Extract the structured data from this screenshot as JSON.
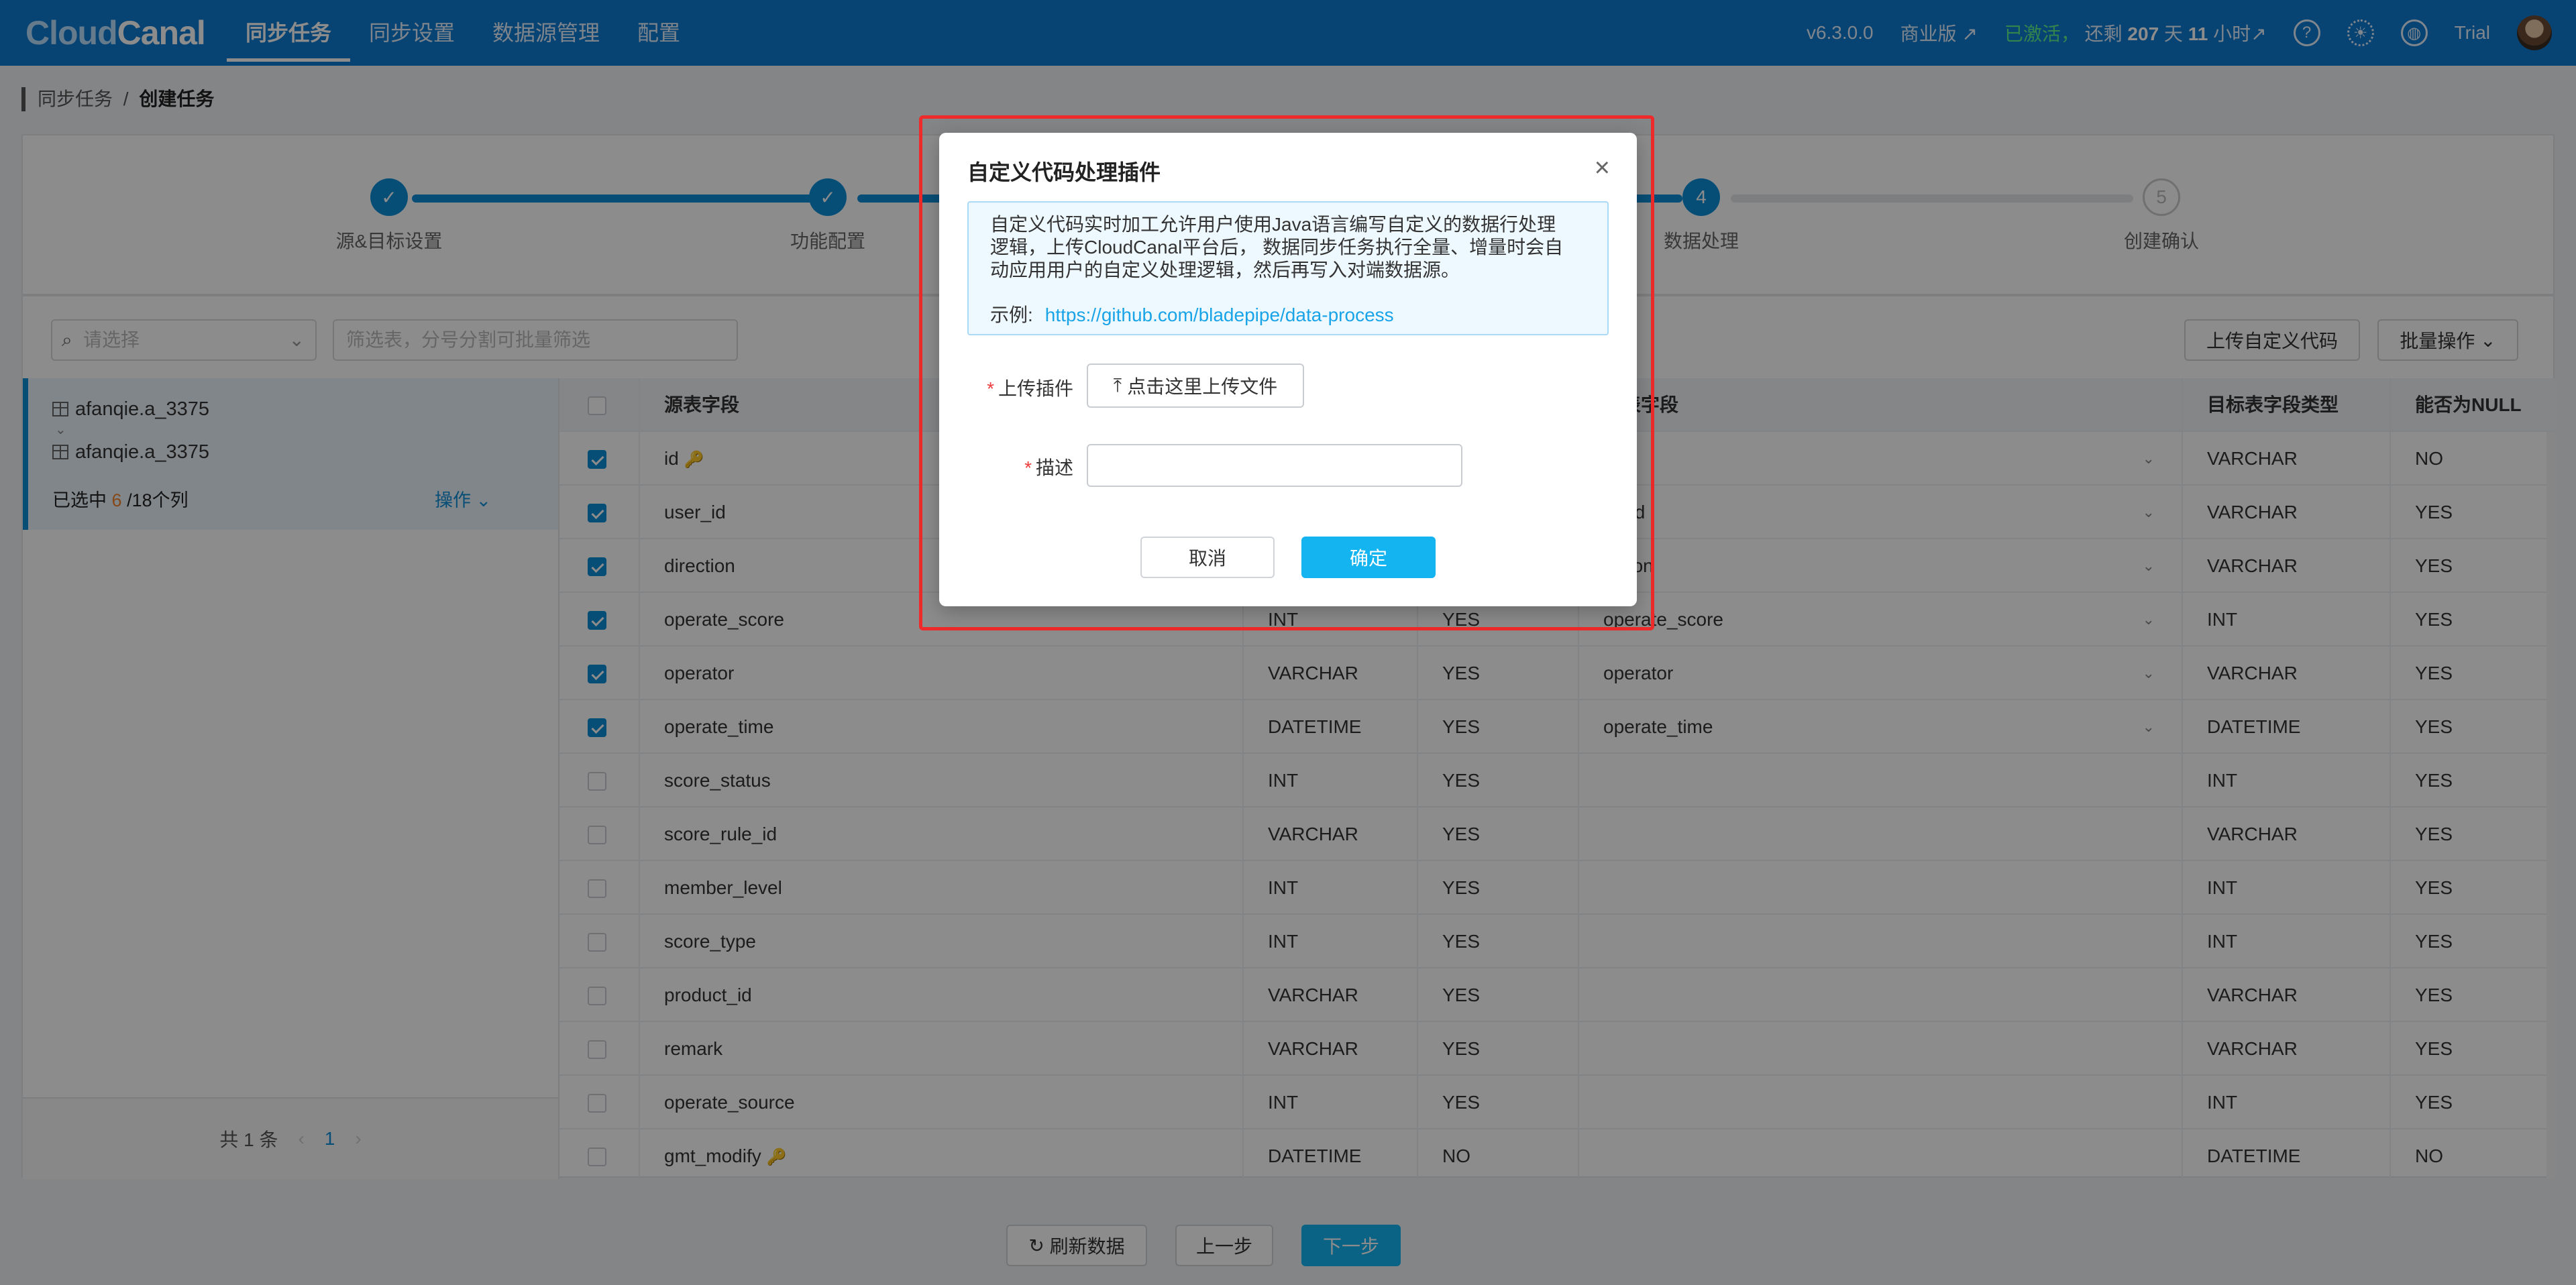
{
  "topbar": {
    "logo_a": "Cloud",
    "logo_b": "Canal",
    "nav": [
      "同步任务",
      "同步设置",
      "数据源管理",
      "配置"
    ],
    "version": "v6.3.0.0",
    "edition": "商业版 ↗",
    "activated": "已激活，",
    "remain_prefix": "还剩",
    "remain_days": "207",
    "remain_days_unit": "天",
    "remain_hours": "11",
    "remain_hours_unit": "小时",
    "remain_arrow": "↗",
    "help_icon": "?",
    "user": "Trial"
  },
  "breadcrumb": {
    "parent": "同步任务",
    "sep": "/",
    "current": "创建任务"
  },
  "steps": [
    {
      "label": "源&目标设置",
      "status": "done",
      "num": "✓"
    },
    {
      "label": "功能配置",
      "status": "done",
      "num": "✓"
    },
    {
      "label": "数据处理",
      "status": "active",
      "num": "4"
    },
    {
      "label": "创建确认",
      "status": "pending",
      "num": "5"
    }
  ],
  "toolbar": {
    "select_placeholder": "请选择",
    "filter_placeholder": "筛选表，分号分割可批量筛选",
    "upload_code": "上传自定义代码",
    "batch_ops": "批量操作"
  },
  "left_panel": {
    "source_table": "afanqie.a_3375",
    "target_table": "afanqie.a_3375",
    "selected_prefix": "已选中",
    "selected_count": "6",
    "selected_suffix": "/18个列",
    "op_label": "操作",
    "total": "共 1 条",
    "page": "1"
  },
  "table": {
    "headers": [
      "源表字段",
      "",
      "",
      "标表字段",
      "目标表字段类型",
      "能否为NULL"
    ],
    "rows": [
      {
        "checked": true,
        "src": "id",
        "key": true,
        "type": "",
        "null": "",
        "tgt": "",
        "tgt_type": "VARCHAR",
        "tgt_null": "NO"
      },
      {
        "checked": true,
        "src": "user_id",
        "key": false,
        "type": "",
        "null": "",
        "tgt": "er_id",
        "tgt_type": "VARCHAR",
        "tgt_null": "YES"
      },
      {
        "checked": true,
        "src": "direction",
        "key": false,
        "type": "",
        "null": "",
        "tgt": "ection",
        "tgt_type": "VARCHAR",
        "tgt_null": "YES"
      },
      {
        "checked": true,
        "src": "operate_score",
        "key": false,
        "type": "INT",
        "null": "YES",
        "tgt": "operate_score",
        "tgt_type": "INT",
        "tgt_null": "YES"
      },
      {
        "checked": true,
        "src": "operator",
        "key": false,
        "type": "VARCHAR",
        "null": "YES",
        "tgt": "operator",
        "tgt_type": "VARCHAR",
        "tgt_null": "YES"
      },
      {
        "checked": true,
        "src": "operate_time",
        "key": false,
        "type": "DATETIME",
        "null": "YES",
        "tgt": "operate_time",
        "tgt_type": "DATETIME",
        "tgt_null": "YES"
      },
      {
        "checked": false,
        "src": "score_status",
        "key": false,
        "type": "INT",
        "null": "YES",
        "tgt": "",
        "tgt_type": "INT",
        "tgt_null": "YES"
      },
      {
        "checked": false,
        "src": "score_rule_id",
        "key": false,
        "type": "VARCHAR",
        "null": "YES",
        "tgt": "",
        "tgt_type": "VARCHAR",
        "tgt_null": "YES"
      },
      {
        "checked": false,
        "src": "member_level",
        "key": false,
        "type": "INT",
        "null": "YES",
        "tgt": "",
        "tgt_type": "INT",
        "tgt_null": "YES"
      },
      {
        "checked": false,
        "src": "score_type",
        "key": false,
        "type": "INT",
        "null": "YES",
        "tgt": "",
        "tgt_type": "INT",
        "tgt_null": "YES"
      },
      {
        "checked": false,
        "src": "product_id",
        "key": false,
        "type": "VARCHAR",
        "null": "YES",
        "tgt": "",
        "tgt_type": "VARCHAR",
        "tgt_null": "YES"
      },
      {
        "checked": false,
        "src": "remark",
        "key": false,
        "type": "VARCHAR",
        "null": "YES",
        "tgt": "",
        "tgt_type": "VARCHAR",
        "tgt_null": "YES"
      },
      {
        "checked": false,
        "src": "operate_source",
        "key": false,
        "type": "INT",
        "null": "YES",
        "tgt": "",
        "tgt_type": "INT",
        "tgt_null": "YES"
      },
      {
        "checked": false,
        "src": "gmt_modify",
        "key": true,
        "type": "DATETIME",
        "null": "NO",
        "tgt": "",
        "tgt_type": "DATETIME",
        "tgt_null": "NO"
      }
    ]
  },
  "bottom": {
    "refresh": "刷新数据",
    "prev": "上一步",
    "next": "下一步"
  },
  "modal": {
    "title": "自定义代码处理插件",
    "info": "自定义代码实时加工允许用户使用Java语言编写自定义的数据行处理逻辑，上传CloudCanal平台后， 数据同步任务执行全量、增量时会自动应用用户的自定义处理逻辑，然后再写入对端数据源。",
    "example_label": "示例:",
    "example_link": "https://github.com/bladepipe/data-process",
    "upload_label": "上传插件",
    "upload_button": "点击这里上传文件",
    "desc_label": "描述",
    "desc_value": "",
    "cancel": "取消",
    "confirm": "确定"
  },
  "colors": {
    "primary": "#0e7ad1",
    "accent": "#13b4f0",
    "highlight": "#ee2a2a",
    "selected_count": "#f5822b"
  }
}
